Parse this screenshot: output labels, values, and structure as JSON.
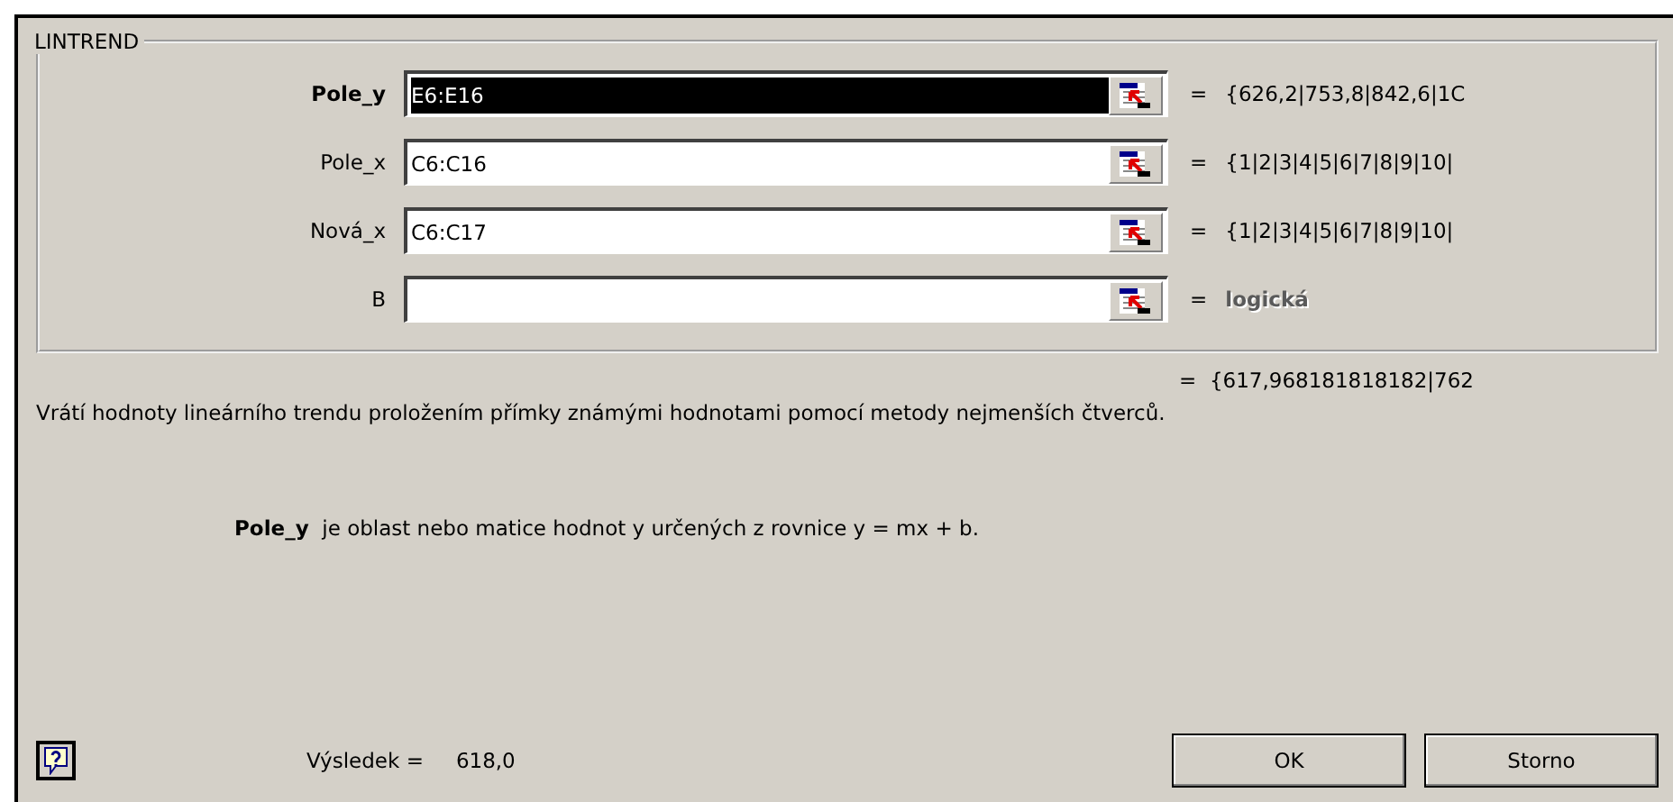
{
  "group": {
    "title": "LINTREND"
  },
  "arguments": [
    {
      "label": "Pole_y",
      "value": "E6:E16",
      "selected": true,
      "result": "{626,2|753,8|842,6|1C",
      "result_is_type": false
    },
    {
      "label": "Pole_x",
      "value": "C6:C16",
      "selected": false,
      "result": "{1|2|3|4|5|6|7|8|9|10|",
      "result_is_type": false
    },
    {
      "label": "Nová_x",
      "value": "C6:C17",
      "selected": false,
      "result": "{1|2|3|4|5|6|7|8|9|10|",
      "result_is_type": false
    },
    {
      "label": "B",
      "selected": false,
      "result": "logická",
      "result_is_type": true
    }
  ],
  "equals": "=",
  "formula_result": "{617,968181818182|762",
  "description": "Vrátí hodnoty lineárního trendu proložením přímky známými hodnotami pomocí metody nejmenších čtverců.",
  "argument_help": {
    "name": "Pole_y",
    "text": "je oblast nebo matice hodnot y určených z rovnice y = mx + b."
  },
  "result_label": "Výsledek =",
  "result_value": "618,0",
  "buttons": [
    "OK",
    "Storno"
  ]
}
